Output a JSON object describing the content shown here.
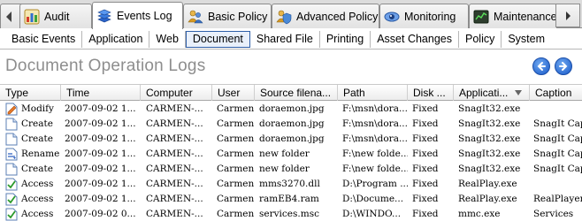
{
  "tabs": [
    {
      "label": "Audit",
      "icon": "bar-chart-icon"
    },
    {
      "label": "Events Log",
      "icon": "stacked-log-icon"
    },
    {
      "label": "Basic Policy",
      "icon": "users-policy-icon"
    },
    {
      "label": "Advanced Policy",
      "icon": "users-shield-icon"
    },
    {
      "label": "Monitoring",
      "icon": "monitor-eye-icon"
    },
    {
      "label": "Maintenance",
      "icon": "console-icon"
    }
  ],
  "subtabs": [
    "Basic Events",
    "Application",
    "Web",
    "Document",
    "Shared File",
    "Printing",
    "Asset Changes",
    "Policy",
    "System"
  ],
  "active_subtab": "Document",
  "header": {
    "title": "Document Operation Logs"
  },
  "grid": {
    "columns": [
      "Type",
      "Time",
      "Computer",
      "User",
      "Source filena...",
      "Path",
      "Disk ...",
      "Applicati...",
      "Caption"
    ],
    "rows": [
      {
        "type": "Modify",
        "icon": "modify-document-icon",
        "time": "2007-09-02 1...",
        "computer": "CARMEN-...",
        "user": "Carmen",
        "source": "doraemon.jpg",
        "path": "F:\\msn\\dora...",
        "disk": "Fixed",
        "app": "SnagIt32.exe",
        "caption": ""
      },
      {
        "type": "Create",
        "icon": "new-document-icon",
        "time": "2007-09-02 1...",
        "computer": "CARMEN-...",
        "user": "Carmen",
        "source": "doraemon.jpg",
        "path": "F:\\msn\\dora...",
        "disk": "Fixed",
        "app": "SnagIt32.exe",
        "caption": "SnagIt Cap"
      },
      {
        "type": "Create",
        "icon": "new-document-icon",
        "time": "2007-09-02 1...",
        "computer": "CARMEN-...",
        "user": "Carmen",
        "source": "doraemon.jpg",
        "path": "F:\\msn\\dora...",
        "disk": "Fixed",
        "app": "SnagIt32.exe",
        "caption": "SnagIt Cap"
      },
      {
        "type": "Rename",
        "icon": "rename-document-icon",
        "time": "2007-09-02 1...",
        "computer": "CARMEN-...",
        "user": "Carmen",
        "source": "new folder",
        "path": "F:\\new folde...",
        "disk": "Fixed",
        "app": "SnagIt32.exe",
        "caption": "SnagIt Cap"
      },
      {
        "type": "Create",
        "icon": "new-document-icon",
        "time": "2007-09-02 1...",
        "computer": "CARMEN-...",
        "user": "Carmen",
        "source": "new folder",
        "path": "F:\\new folde...",
        "disk": "Fixed",
        "app": "SnagIt32.exe",
        "caption": "SnagIt Cap"
      },
      {
        "type": "Access",
        "icon": "access-document-icon",
        "time": "2007-09-02 1...",
        "computer": "CARMEN-...",
        "user": "Carmen",
        "source": "mms3270.dll",
        "path": "D:\\Program ...",
        "disk": "Fixed",
        "app": "RealPlay.exe",
        "caption": ""
      },
      {
        "type": "Access",
        "icon": "access-document-icon",
        "time": "2007-09-02 1...",
        "computer": "CARMEN-...",
        "user": "Carmen",
        "source": "ramEB4.ram",
        "path": "D:\\Docume...",
        "disk": "Fixed",
        "app": "RealPlay.exe",
        "caption": "RealPlayer"
      },
      {
        "type": "Access",
        "icon": "access-document-icon",
        "time": "2007-09-02 0...",
        "computer": "CARMEN-...",
        "user": "Carmen",
        "source": "services.msc",
        "path": "D:\\WINDO...",
        "disk": "Fixed",
        "app": "mmc.exe",
        "caption": "Services"
      }
    ]
  },
  "colors": {
    "title": "#8e8e8e",
    "nav_button": "#1758c8",
    "active_subtab_border": "#2f5fa8"
  }
}
